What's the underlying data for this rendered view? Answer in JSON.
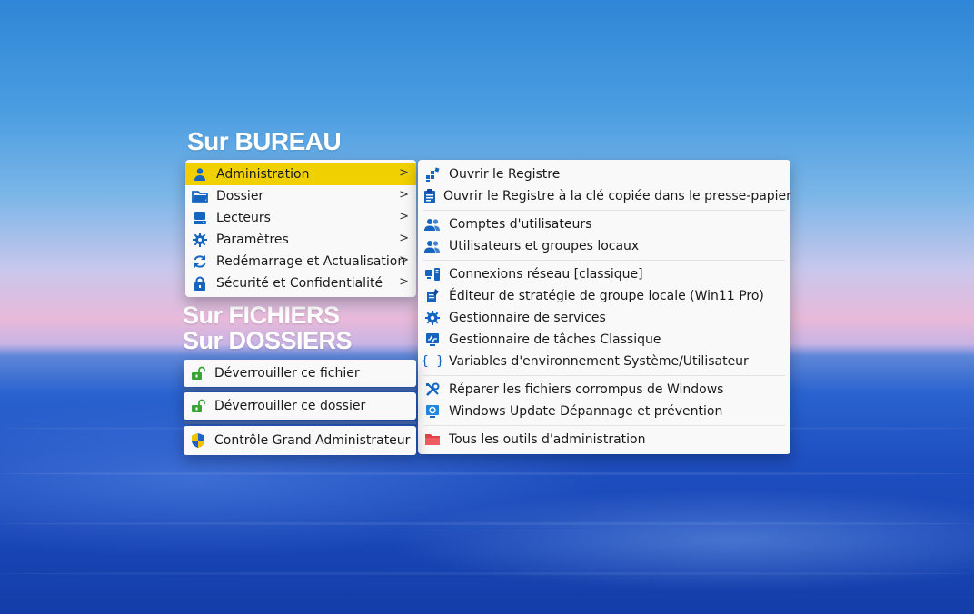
{
  "headings": {
    "bureau": "Sur BUREAU",
    "fichiers": "Sur FICHIERS",
    "dossiers": "Sur DOSSIERS"
  },
  "main_menu": [
    {
      "label": "Administration",
      "icon": "user-icon",
      "selected": true
    },
    {
      "label": "Dossier",
      "icon": "folder-icon"
    },
    {
      "label": "Lecteurs",
      "icon": "drive-icon"
    },
    {
      "label": "Paramètres",
      "icon": "gear-icon"
    },
    {
      "label": "Redémarrage et Actualisation",
      "icon": "refresh-icon"
    },
    {
      "label": "Sécurité et Confidentialité",
      "icon": "lock-icon"
    }
  ],
  "submenu_arrow": ">",
  "submenu": [
    {
      "label": "Ouvrir le Registre",
      "icon": "registry-icon"
    },
    {
      "label": "Ouvrir le Registre à la clé copiée dans le presse-papier",
      "icon": "registry-clipboard-icon"
    },
    {
      "label": "Comptes d'utilisateurs",
      "icon": "users-icon"
    },
    {
      "label": "Utilisateurs et groupes locaux",
      "icon": "users-group-icon"
    },
    {
      "label": "Connexions réseau [classique]",
      "icon": "network-icon"
    },
    {
      "label": "Éditeur de stratégie de groupe locale (Win11 Pro)",
      "icon": "policy-editor-icon"
    },
    {
      "label": "Gestionnaire de services",
      "icon": "services-gear-icon"
    },
    {
      "label": "Gestionnaire de tâches Classique",
      "icon": "task-manager-icon"
    },
    {
      "label": "Variables d'environnement Système/Utilisateur",
      "icon": "braces-icon"
    },
    {
      "label": "Réparer les fichiers corrompus de Windows",
      "icon": "tools-icon"
    },
    {
      "label": "Windows Update Dépannage et prévention",
      "icon": "windows-update-icon"
    },
    {
      "label": "Tous les outils d'administration",
      "icon": "red-folder-icon"
    }
  ],
  "file_menu": {
    "label": "Déverrouiller ce fichier",
    "icon": "unlock-icon"
  },
  "folder_menu": {
    "label": "Déverrouiller ce dossier",
    "icon": "unlock-icon"
  },
  "admin_menu": {
    "label": "Contrôle Grand Administrateur",
    "icon": "uac-shield-icon"
  },
  "colors": {
    "selection": "#f0d000",
    "icon_blue": "#1565c0",
    "unlock_green": "#3aa335",
    "folder_red": "#e0444b"
  }
}
